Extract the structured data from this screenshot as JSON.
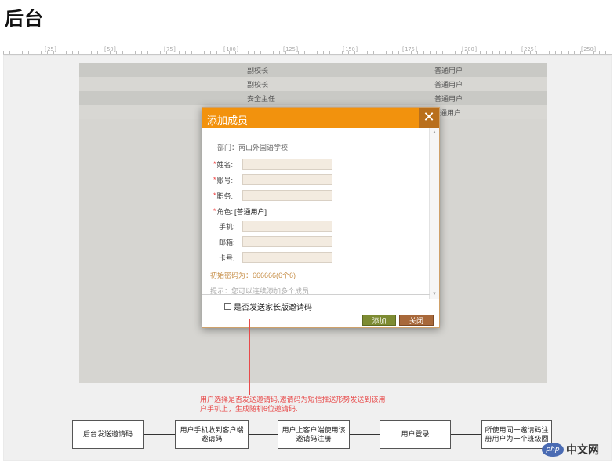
{
  "page": {
    "title": "后台"
  },
  "ruler": {
    "marks": [
      "[25]",
      "[50]",
      "[75]",
      "[100]",
      "[125]",
      "[150]",
      "[175]",
      "[200]",
      "[225]",
      "[250]"
    ]
  },
  "table": {
    "rows": [
      {
        "role": "副校长",
        "type": "普通用户"
      },
      {
        "role": "副校长",
        "type": "普通用户"
      },
      {
        "role": "安全主任",
        "type": "普通用户"
      },
      {
        "role": "",
        "type": "通用户"
      }
    ]
  },
  "modal": {
    "title": "添加成员",
    "close_symbol": "✕",
    "department": "部门：南山外国语学校",
    "fields": {
      "name_label": "姓名:",
      "account_label": "账号:",
      "position_label": "职务:",
      "role_label": "角色:",
      "role_value": "[普通用户]",
      "phone_label": "手机:",
      "email_label": "邮箱:",
      "card_label": "卡号:"
    },
    "required_mark": "*",
    "initial_password_hint": "初始密码为：666666(6个6)",
    "tip": "提示：您可以连续添加多个成员",
    "checkbox_label": "是否发送家长版邀请码",
    "add_button": "添加",
    "close_button": "关闭"
  },
  "annotation": {
    "line1": "用户选择是否发送邀请码,邀请码为短信推送形势发送到该用",
    "line2": "户手机上，生成随机6位邀请码."
  },
  "flow": {
    "steps": [
      "后台发送邀请码",
      "用户手机收到客户端邀请码",
      "用户上客户端使用该邀请码注册",
      "用户登录",
      "所使用同一邀请码注册用户为一个班级圈"
    ]
  },
  "watermark": {
    "logo": "php",
    "text": "中文网"
  },
  "colors": {
    "header": "#f2920d",
    "close_bg": "#b96f1c",
    "annotation": "#e84a4a",
    "add_button": "#7d8b32",
    "close_button": "#a8683a"
  }
}
